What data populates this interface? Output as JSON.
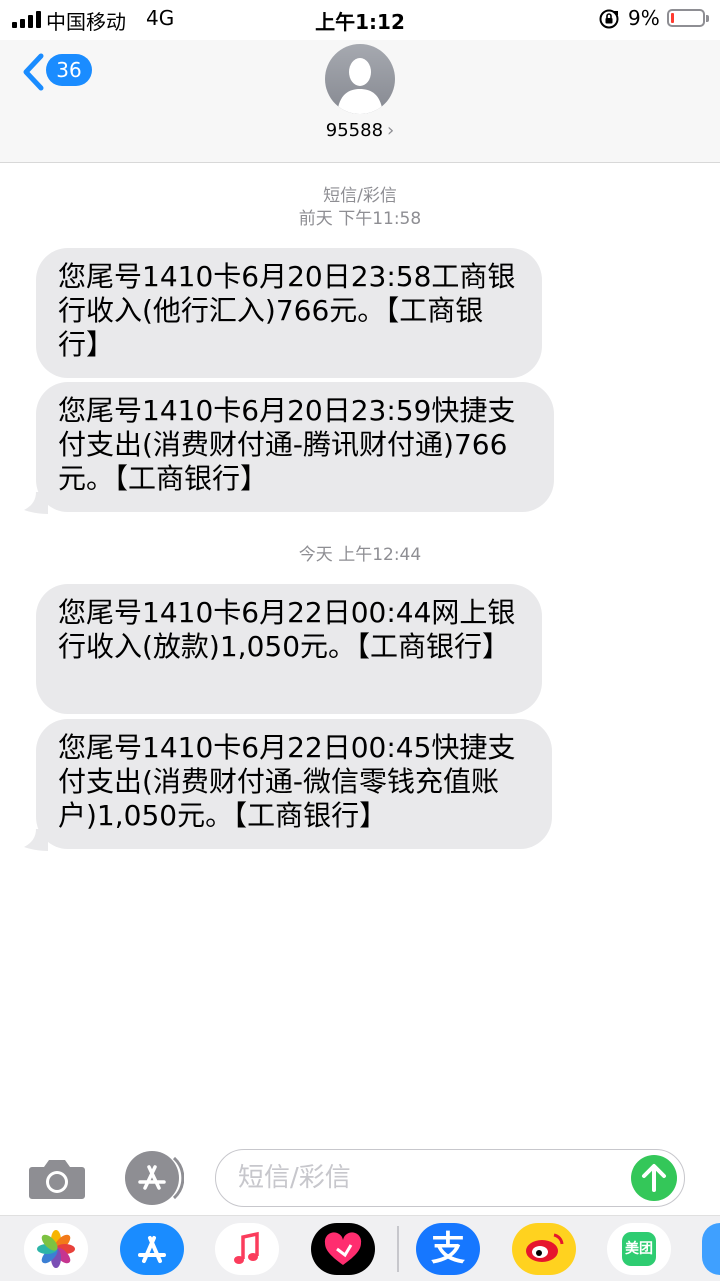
{
  "status_bar": {
    "carrier": "中国移动",
    "network": "4G",
    "time": "上午1:12",
    "battery_percent": "9%",
    "battery_level": 0.09
  },
  "header": {
    "back_count": "36",
    "contact_name": "95588",
    "contact_chevron": "›"
  },
  "conversation": {
    "service_label": "短信/彩信",
    "group1_time": "前天 下午11:58",
    "group2_time": "今天 上午12:44",
    "messages": [
      "您尾号1410卡6月20日23:58工商银行收入(他行汇入)766元。【工商银行】",
      "您尾号1410卡6月20日23:59快捷支付支出(消费财付通-腾讯财付通)766元。【工商银行】",
      "您尾号1410卡6月22日00:44网上银行收入(放款)1,050元。【工商银行】",
      "您尾号1410卡6月22日00:45快捷支付支出(消费财付通-微信零钱充值账户)1,050元。【工商银行】"
    ]
  },
  "compose": {
    "placeholder": "短信/彩信"
  },
  "app_drawer": {
    "meituan_label": "美团",
    "alipay_label": "支"
  },
  "icons": {
    "camera": "camera-icon",
    "appstore": "app-store-icon",
    "send": "arrow-up-icon",
    "back": "chevron-left-icon"
  },
  "colors": {
    "accent": "#1a8cff",
    "send": "#34c759",
    "bubble": "#e9e9eb",
    "battery_low": "#ff3b30"
  }
}
